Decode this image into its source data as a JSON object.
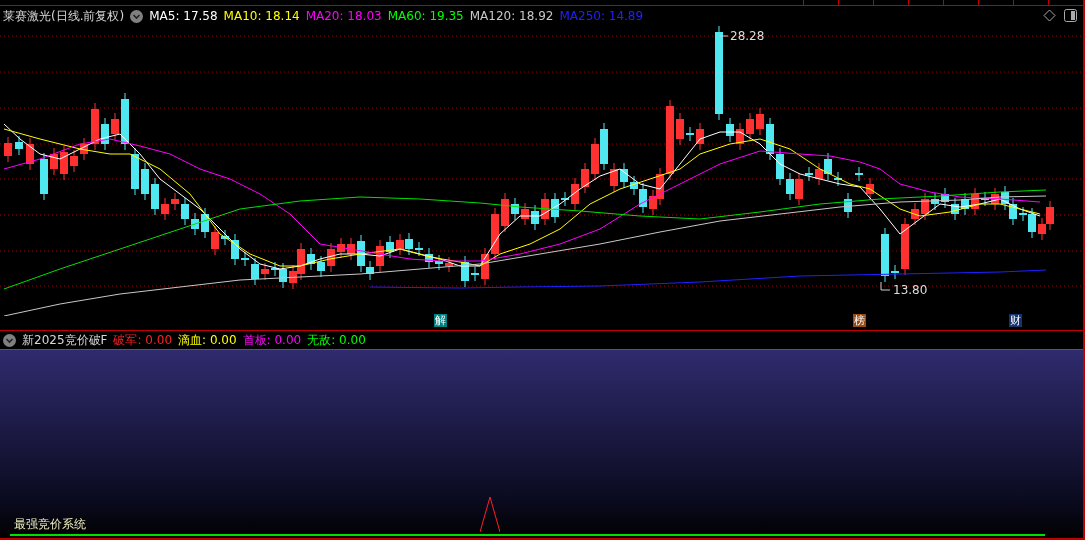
{
  "stock_header": {
    "title": "莱赛激光(日线.前复权)",
    "moving_averages": [
      {
        "label": "MA5: 17.58",
        "color": "#ffffff"
      },
      {
        "label": "MA10: 18.14",
        "color": "#ffff00"
      },
      {
        "label": "MA20: 18.03",
        "color": "#ff00ff"
      },
      {
        "label": "MA60: 19.35",
        "color": "#00ff00"
      },
      {
        "label": "MA120: 18.92",
        "color": "#c8c8c8"
      },
      {
        "label": "MA250: 14.89",
        "color": "#2020ff"
      }
    ]
  },
  "price_chart": {
    "high_label": "28.28",
    "low_label": "13.80"
  },
  "event_markers": [
    {
      "label": "解",
      "color": "#008080"
    },
    {
      "label": "榜",
      "color": "#9a4a14"
    },
    {
      "label": "财",
      "color": "#16336e"
    }
  ],
  "indicator": {
    "title": "新2025竞价破F",
    "values": [
      {
        "label": "破军: 0.00",
        "color": "#ff2020"
      },
      {
        "label": "滴血: 0.00",
        "color": "#ffff00"
      },
      {
        "label": "首板: 0.00",
        "color": "#ff00ff"
      },
      {
        "label": "无敌: 0.00",
        "color": "#00ff00"
      }
    ]
  },
  "panel_caption": "最强竞价系统"
}
